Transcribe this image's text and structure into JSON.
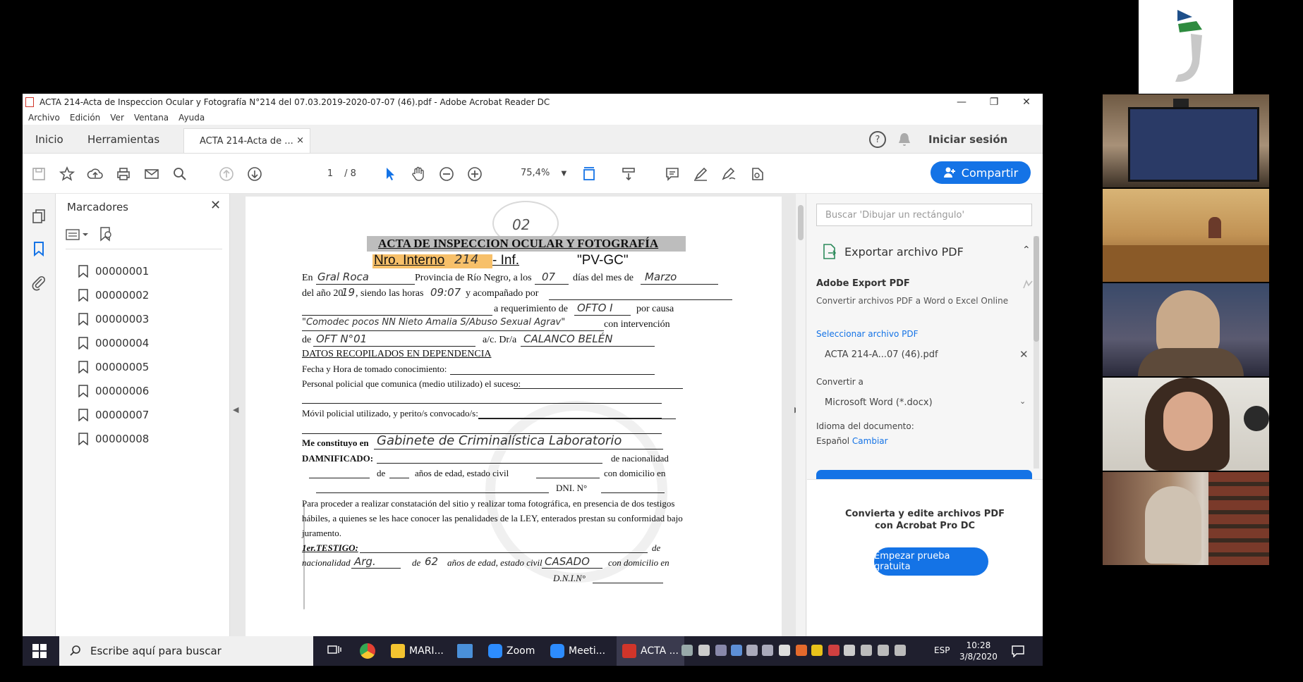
{
  "window": {
    "title": "ACTA 214-Acta de Inspeccion Ocular y Fotografía N°214 del 07.03.2019-2020-07-07 (46).pdf - Adobe Acrobat Reader DC",
    "min": "—",
    "max": "❐",
    "close": "✕"
  },
  "menu": [
    "Archivo",
    "Edición",
    "Ver",
    "Ventana",
    "Ayuda"
  ],
  "tabs": {
    "home": "Inicio",
    "tools": "Herramientas",
    "doc": "ACTA 214-Acta de ...",
    "doc_close": "×"
  },
  "header": {
    "help": "?",
    "signin": "Iniciar sesión"
  },
  "toolbar": {
    "page_current": "1",
    "page_total": "/ 8",
    "zoom": "75,4%",
    "share": "Compartir"
  },
  "bookmarks": {
    "title": "Marcadores",
    "close": "✕",
    "items": [
      "00000001",
      "00000002",
      "00000003",
      "00000004",
      "00000005",
      "00000006",
      "00000007",
      "00000008"
    ]
  },
  "document": {
    "stamp": "02",
    "heading": "ACTA DE INSPECCION OCULAR Y FOTOGRAFÍA",
    "nro_label": "Nro. Interno",
    "nro_value": "214",
    "inf_label": "- Inf.",
    "code": "\"PV-GC\"",
    "l_en": "En",
    "hw_city": "Gral Roca",
    "l_prov": "Provincia de Río Negro, a los",
    "hw_day": "07",
    "l_dias": "días del mes de",
    "hw_month": "Marzo",
    "l_anio": "del año 20",
    "hw_year": "19",
    "l_horas": ", siendo las horas",
    "hw_hour": "09:07",
    "l_acomp": "y acompañado por",
    "l_req": "a   requerimiento   de",
    "hw_req": "OFTO I",
    "l_causa": "por causa",
    "hw_causa": "\"Comodec pocos NN Nieto Amalia S/Abuso Sexual Agrav\"",
    "l_interv": "con   intervención",
    "l_de": "de",
    "hw_of": "OFT N°01",
    "l_dra": "a/c. Dr/a",
    "hw_dra": "CALANCO BELÉN",
    "section": "DATOS RECOPILADOS EN DEPENDENCIA",
    "l_fecha": "Fecha y Hora de tomado conocimiento:",
    "l_personal": "Personal policial que comunica (medio utilizado) el suceso:",
    "l_movil": "Móvil policial utilizado, y perito/s convocado/s:",
    "l_constituyo": "Me constituyo en",
    "hw_lugar": "Gabinete de Criminalística Laboratorio",
    "l_damnificado": "DAMNIFICADO:",
    "l_nacionalidad": "de nacionalidad",
    "l_de2": "de",
    "l_edad": "años de edad, estado civil",
    "l_domicilio": "con domicilio en",
    "l_dni": "DNI.   N°",
    "paragraph1": "Para proceder a realizar constatación del sitio y realizar toma fotográfica, en presencia de dos testigos",
    "paragraph2": "hábiles, a quienes se les hace conocer las penalidades de la LEY, enterados prestan su conformidad bajo",
    "paragraph3": "juramento.",
    "l_testigo": "1er.TESTIGO:",
    "l_de3": "de",
    "l_nac2": "nacionalidad",
    "hw_nac": "Arg.",
    "l_de4": "de",
    "hw_age": "62",
    "l_edad2": "años de edad, estado civil",
    "hw_civil": "CASADO",
    "l_dom2": "con domicilio en",
    "l_dni2": "D.N.I.N°"
  },
  "right_pane": {
    "search_placeholder": "Buscar 'Dibujar un rectángulo'",
    "export_title": "Exportar archivo PDF",
    "export_brand": "Adobe Export PDF",
    "export_desc": "Convertir archivos PDF a Word o Excel Online",
    "select_label": "Seleccionar archivo PDF",
    "file_name": "ACTA 214-A...07 (46).pdf",
    "convert_label": "Convertir a",
    "convert_value": "Microsoft Word (*.docx)",
    "lang_label": "Idioma del documento:",
    "lang_value": "Español",
    "lang_change": "Cambiar",
    "promo_line1": "Convierta y edite archivos PDF",
    "promo_line2": "con Acrobat Pro DC",
    "trial_button": "Empezar prueba gratuita"
  },
  "taskbar": {
    "search_placeholder": "Escribe aquí para buscar",
    "apps": [
      {
        "label": "MARI...",
        "color": "#f4c430"
      },
      {
        "label": "Zoom",
        "color": "#2d8cff"
      },
      {
        "label": "Meeti...",
        "color": "#2d8cff"
      },
      {
        "label": "ACTA ...",
        "color": "#d0352a"
      }
    ],
    "lang": "ESP",
    "time": "10:28",
    "date": "3/8/2020"
  },
  "colors": {
    "accent": "#1473e6",
    "pdf_red": "#d0352a",
    "taskbar": "#1f1f2e",
    "highlight": "#f7c06a"
  }
}
